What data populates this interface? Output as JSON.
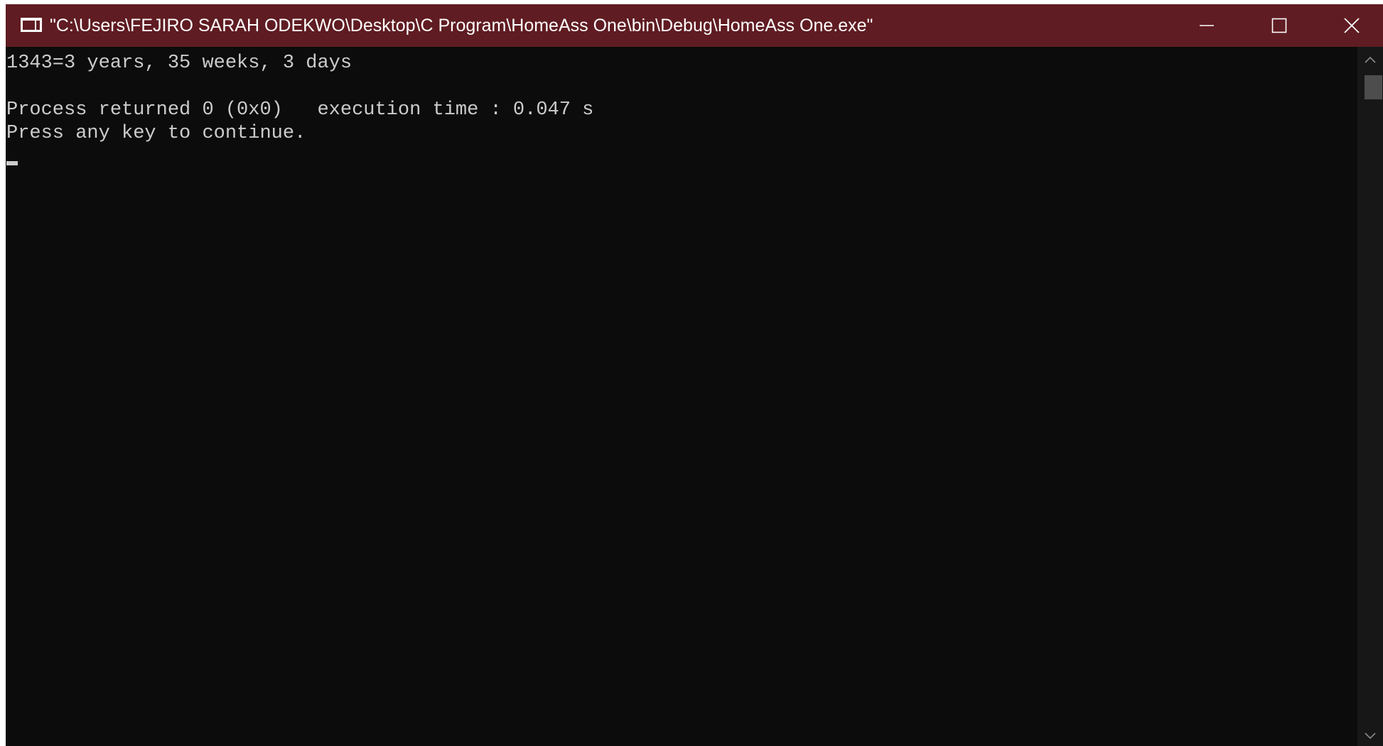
{
  "window": {
    "title": "\"C:\\Users\\FEJIRO SARAH ODEKWO\\Desktop\\C Program\\HomeAss One\\bin\\Debug\\HomeAss One.exe\"",
    "titlebar_color": "#5f1c22",
    "background_color": "#0c0c0c",
    "app_icon": "console-app-icon",
    "controls": {
      "minimize_icon": "minimize-icon",
      "maximize_icon": "maximize-icon",
      "close_icon": "close-icon"
    }
  },
  "console": {
    "text_color": "#cccccc",
    "lines": [
      "1343=3 years, 35 weeks, 3 days",
      "Process returned 0 (0x0)   execution time : 0.047 s",
      "Press any key to continue."
    ]
  },
  "scrollbar": {
    "up_icon": "scroll-up-arrow-icon",
    "down_icon": "scroll-down-arrow-icon"
  }
}
